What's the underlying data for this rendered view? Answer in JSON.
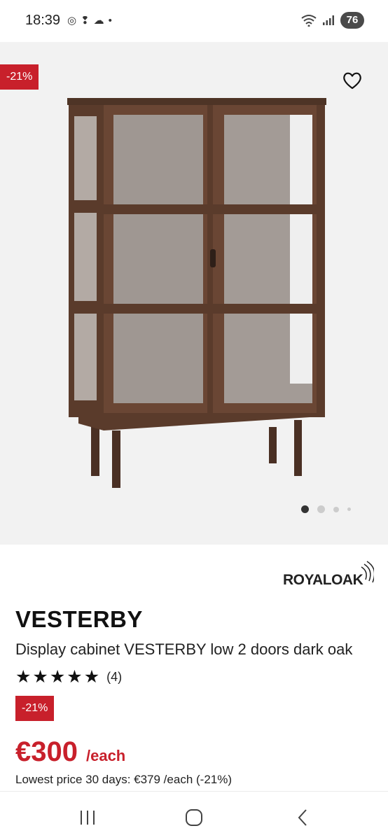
{
  "status_bar": {
    "time": "18:39",
    "battery": "76",
    "icons": [
      "chrome-icon",
      "notification-icon",
      "cloud-icon",
      "dot-icon",
      "wifi-icon",
      "signal-icon"
    ]
  },
  "gallery": {
    "discount_badge": "-21%",
    "image_count": 4,
    "active_index": 0
  },
  "product": {
    "brand": "ROYALOAK",
    "name": "VESTERBY",
    "description": "Display cabinet VESTERBY low 2 doors dark oak",
    "rating": 5,
    "review_count": "(4)",
    "discount_badge": "-21%",
    "price": "€300",
    "price_unit": "/each",
    "lowest_price": "Lowest price 30 days: €379 /each (-21%)"
  },
  "colors": {
    "accent_red": "#c8202b",
    "wood_dark": "#5a3b2b",
    "gallery_bg": "#f2f2f2"
  }
}
